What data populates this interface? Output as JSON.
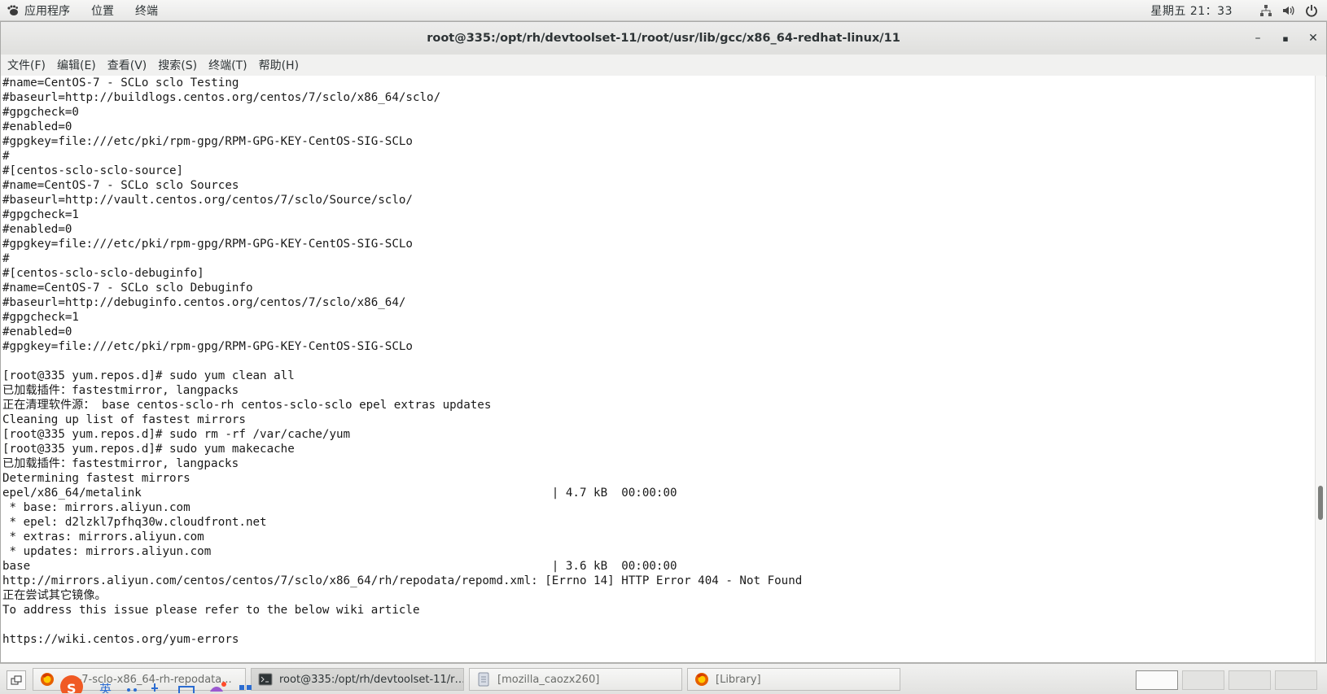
{
  "top_panel": {
    "applications": "应用程序",
    "places": "位置",
    "terminal": "终端",
    "clock": "星期五 21：33",
    "icons": [
      "network-icon",
      "volume-icon",
      "power-icon"
    ]
  },
  "window": {
    "title": "root@335:/opt/rh/devtoolset-11/root/usr/lib/gcc/x86_64-redhat-linux/11",
    "minimize": "–",
    "maximize": "▪",
    "close": "✕"
  },
  "menubar": {
    "items": [
      "文件(F)",
      "编辑(E)",
      "查看(V)",
      "搜索(S)",
      "终端(T)",
      "帮助(H)"
    ]
  },
  "terminal": {
    "lines": [
      "#name=CentOS-7 - SCLo sclo Testing",
      "#baseurl=http://buildlogs.centos.org/centos/7/sclo/x86_64/sclo/",
      "#gpgcheck=0",
      "#enabled=0",
      "#gpgkey=file:///etc/pki/rpm-gpg/RPM-GPG-KEY-CentOS-SIG-SCLo",
      "#",
      "#[centos-sclo-sclo-source]",
      "#name=CentOS-7 - SCLo sclo Sources",
      "#baseurl=http://vault.centos.org/centos/7/sclo/Source/sclo/",
      "#gpgcheck=1",
      "#enabled=0",
      "#gpgkey=file:///etc/pki/rpm-gpg/RPM-GPG-KEY-CentOS-SIG-SCLo",
      "#",
      "#[centos-sclo-sclo-debuginfo]",
      "#name=CentOS-7 - SCLo sclo Debuginfo",
      "#baseurl=http://debuginfo.centos.org/centos/7/sclo/x86_64/",
      "#gpgcheck=1",
      "#enabled=0",
      "#gpgkey=file:///etc/pki/rpm-gpg/RPM-GPG-KEY-CentOS-SIG-SCLo",
      "",
      "[root@335 yum.repos.d]# sudo yum clean all",
      "已加载插件：fastestmirror, langpacks",
      "正在清理软件源： base centos-sclo-rh centos-sclo-sclo epel extras updates",
      "Cleaning up list of fastest mirrors",
      "[root@335 yum.repos.d]# sudo rm -rf /var/cache/yum",
      "[root@335 yum.repos.d]# sudo yum makecache",
      "已加载插件：fastestmirror, langpacks",
      "Determining fastest mirrors",
      "epel/x86_64/metalink                                                           | 4.7 kB  00:00:00",
      " * base: mirrors.aliyun.com",
      " * epel: d2lzkl7pfhq30w.cloudfront.net",
      " * extras: mirrors.aliyun.com",
      " * updates: mirrors.aliyun.com",
      "base                                                                           | 3.6 kB  00:00:00",
      "http://mirrors.aliyun.com/centos/centos/7/sclo/x86_64/rh/repodata/repomd.xml: [Errno 14] HTTP Error 404 - Not Found",
      "正在尝试其它镜像。",
      "To address this issue please refer to the below wiki article",
      "",
      "https://wiki.centos.org/yum-errors"
    ]
  },
  "taskbar": {
    "tasks": [
      {
        "label": "...o-7-sclo-x86_64-rh-repodata...",
        "icon": "firefox-icon"
      },
      {
        "label": "root@335:/opt/rh/devtoolset-11/r…",
        "icon": "terminal-icon"
      },
      {
        "label": "[mozilla_caozx260]",
        "icon": "file-manager-icon"
      },
      {
        "label": "[Library]",
        "icon": "firefox-icon"
      }
    ],
    "workspaces": 4
  }
}
